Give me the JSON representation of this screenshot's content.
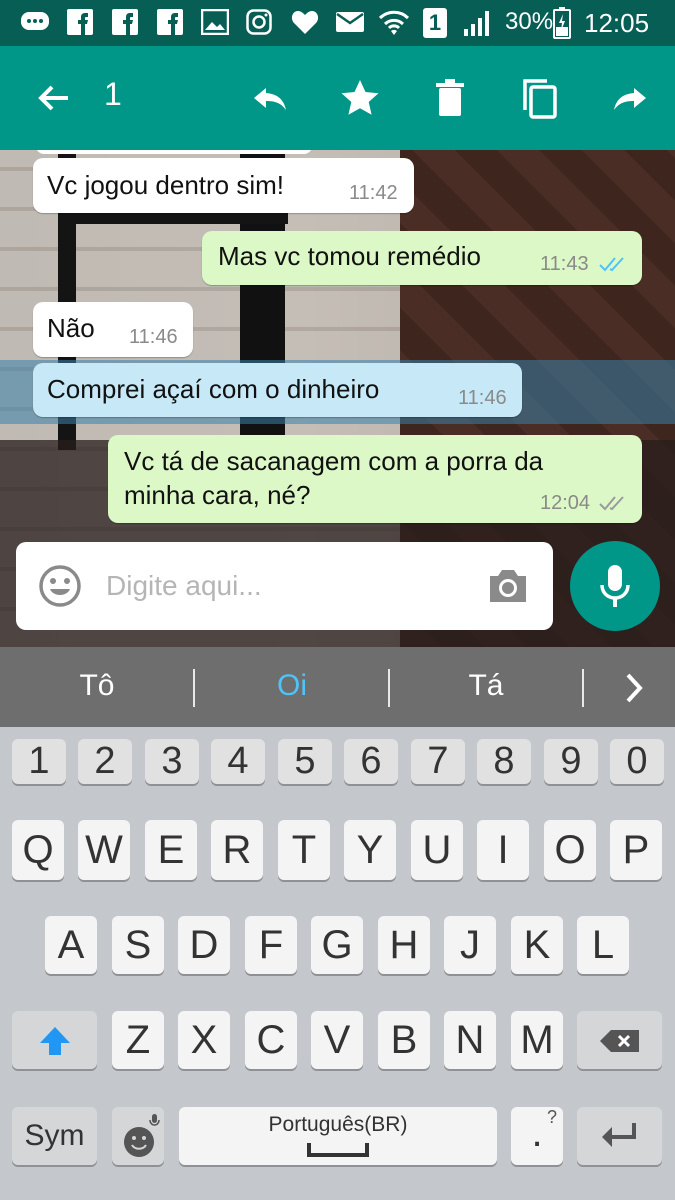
{
  "status_bar": {
    "sim_badge": "1",
    "battery_percent": "30%",
    "time": "12:05",
    "icons": [
      "chat-notification-icon",
      "facebook-icon",
      "facebook-icon",
      "facebook-icon",
      "gallery-icon",
      "instagram-icon",
      "heart-icon",
      "mail-icon",
      "wifi-icon",
      "sim-icon",
      "signal-icon",
      "battery-icon"
    ]
  },
  "toolbar": {
    "selected_count": "1",
    "actions": [
      "back",
      "reply",
      "star",
      "delete",
      "copy",
      "forward"
    ]
  },
  "messages": [
    {
      "direction": "in",
      "text": "Vc jogou dentro sim!",
      "time": "11:42",
      "selected": false
    },
    {
      "direction": "out",
      "text": "Mas vc tomou remédio",
      "time": "11:43",
      "status": "read",
      "selected": false
    },
    {
      "direction": "in",
      "text": "Não",
      "time": "11:46",
      "selected": false
    },
    {
      "direction": "in",
      "text": "Comprei açaí com o dinheiro",
      "time": "11:46",
      "selected": true
    },
    {
      "direction": "out",
      "text_line1": "Vc tá de sacanagem com a porra da",
      "text_line2": "minha cara, né?",
      "time": "12:04",
      "status": "delivered",
      "selected": false
    }
  ],
  "input": {
    "placeholder": "Digite aqui..."
  },
  "suggestions": [
    "Tô",
    "Oi",
    "Tá"
  ],
  "keyboard": {
    "numbers": [
      "1",
      "2",
      "3",
      "4",
      "5",
      "6",
      "7",
      "8",
      "9",
      "0"
    ],
    "row1": [
      "Q",
      "W",
      "E",
      "R",
      "T",
      "Y",
      "U",
      "I",
      "O",
      "P"
    ],
    "row2": [
      "A",
      "S",
      "D",
      "F",
      "G",
      "H",
      "J",
      "K",
      "L"
    ],
    "row3": [
      "Z",
      "X",
      "C",
      "V",
      "B",
      "N",
      "M"
    ],
    "sym_label": "Sym",
    "space_label": "Português(BR)",
    "period_label": ".",
    "period_hint": "?"
  },
  "colors": {
    "toolbar": "#009688",
    "status_bar": "#075e54",
    "outgoing_bubble": "#dcf8c6",
    "selected_bubble": "#c7e8f6",
    "read_ticks": "#4fc3f7",
    "suggestion_highlight": "#4fc3f7"
  }
}
